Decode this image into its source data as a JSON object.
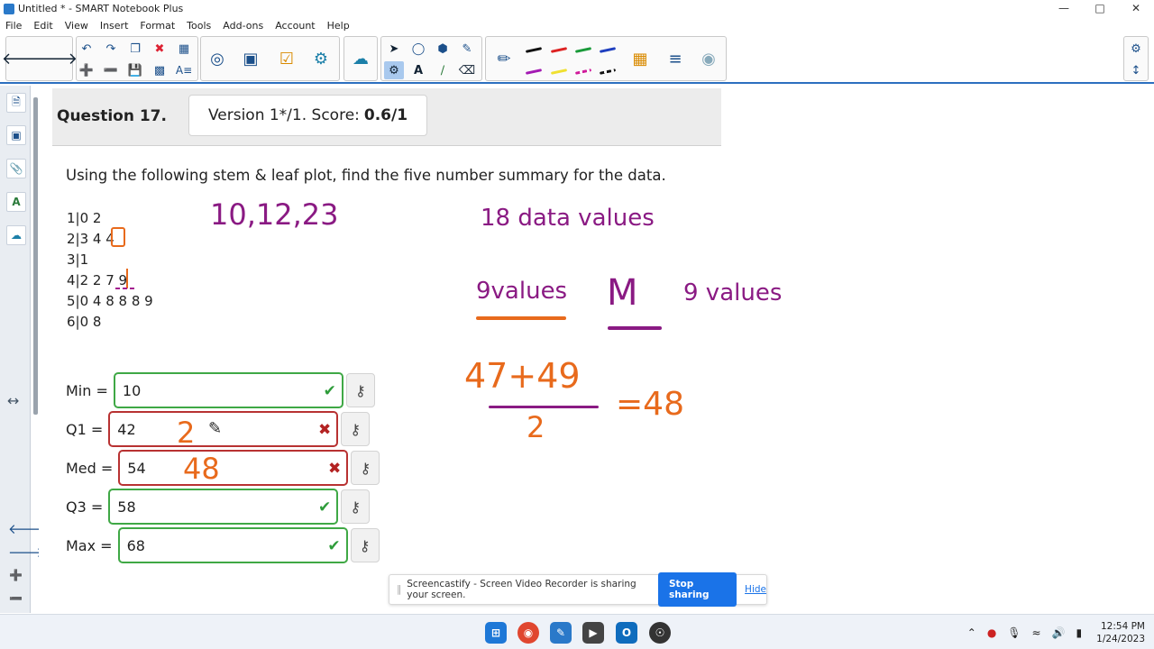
{
  "window": {
    "title": "Untitled * - SMART Notebook Plus"
  },
  "menu": [
    "File",
    "Edit",
    "View",
    "Insert",
    "Format",
    "Tools",
    "Add-ons",
    "Account",
    "Help"
  ],
  "colors": {
    "accent": "#2c6fbf",
    "correct": "#3fa845",
    "incorrect": "#b83232",
    "ink_purple": "#8a1a83",
    "ink_orange": "#e86a1c"
  },
  "question": {
    "title": "Question 17.",
    "version": "Version 1*/1. Score:",
    "score": "0.6/1",
    "prompt": "Using the following stem & leaf plot, find the five number summary for the data.",
    "stem_leaf": [
      "1|0 2",
      "2|3 4 4",
      "3|1",
      "4|2 2 7 9",
      "5|0 4 8 8 8 9",
      "6|0 8"
    ]
  },
  "answers": [
    {
      "label": "Min =",
      "value": "10",
      "status": "correct"
    },
    {
      "label": "Q1 =",
      "value": "42",
      "status": "incorrect"
    },
    {
      "label": "Med =",
      "value": "54",
      "status": "incorrect"
    },
    {
      "label": "Q3 =",
      "value": "58",
      "status": "correct"
    },
    {
      "label": "Max =",
      "value": "68",
      "status": "correct"
    }
  ],
  "annotations": {
    "first_values": "10,12,23",
    "data_count": "18  data  values",
    "left_half": "9values",
    "median_letter": "M",
    "right_half": "9  values",
    "numerator": "47+49",
    "denominator": "2",
    "result": "=48",
    "q1_note": "2",
    "med_note": "48"
  },
  "share_bar": {
    "text": "Screencastify - Screen Video Recorder is sharing your screen.",
    "stop_label": "Stop sharing",
    "hide_label": "Hide"
  },
  "taskbar": {
    "time": "12:54 PM",
    "date": "1/24/2023"
  }
}
